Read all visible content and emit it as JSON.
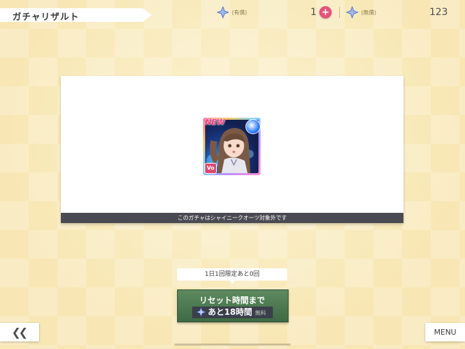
{
  "header": {
    "title": "ガチャリザルト",
    "paid_gems_label": "(有償)",
    "paid_gems_value": "1",
    "free_gems_label": "(無償)",
    "free_gems_value": "123"
  },
  "result_panel": {
    "card": {
      "new_label": "NEW",
      "attribute_badge": "Vo",
      "attribute_icon": "moon-icon"
    },
    "footer_note": "このガチャはシャイニークオーツ対象外です"
  },
  "daily_limit": {
    "text": "1日1回限定あと0回"
  },
  "reset_button": {
    "title": "リセット時間まで",
    "remaining": "あと18時間",
    "free_label": "無料"
  },
  "nav": {
    "back_icon": "double-chevron-left-icon",
    "menu_label": "MENU"
  },
  "colors": {
    "accent_pink": "#e6527a",
    "button_green": "#4a7a50",
    "panel_footer": "#4a4a52"
  }
}
